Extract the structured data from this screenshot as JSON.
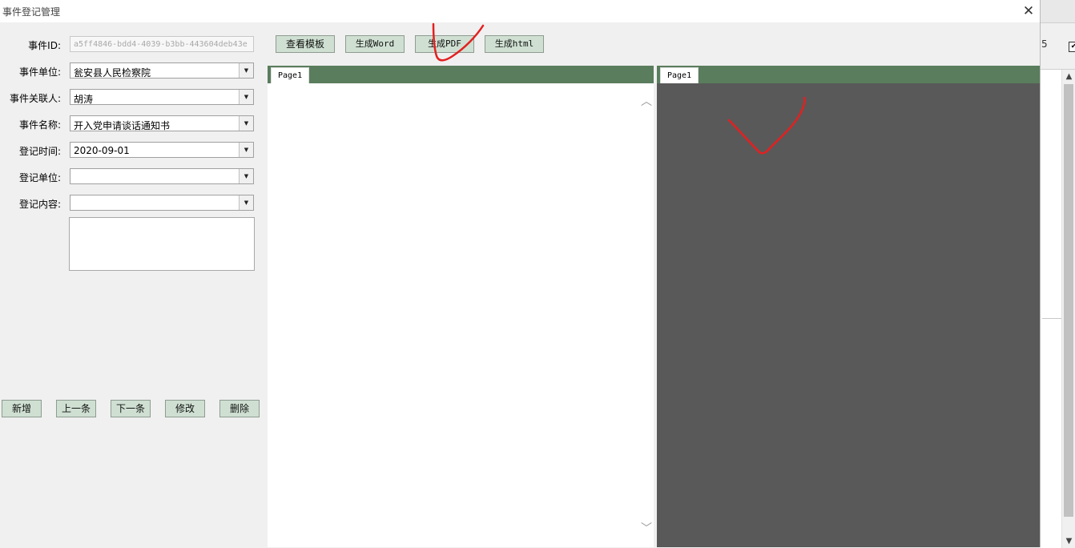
{
  "window": {
    "title": "事件登记管理",
    "close_glyph": "✕"
  },
  "form": {
    "event_id": {
      "label": "事件ID:",
      "value": "a5ff4846-bdd4-4039-b3bb-443604deb43e"
    },
    "event_unit": {
      "label": "事件单位:",
      "value": "瓮安县人民检察院"
    },
    "event_contact": {
      "label": "事件关联人:",
      "value": "胡涛"
    },
    "event_name": {
      "label": "事件名称:",
      "value": "开入党申请谈话通知书"
    },
    "register_time": {
      "label": "登记时间:",
      "value": "2020-09-01"
    },
    "register_unit": {
      "label": "登记单位:",
      "value": ""
    },
    "register_content": {
      "label": "登记内容:",
      "value": ""
    },
    "dropdown_glyph": "▼"
  },
  "toolbar": {
    "view_template": "查看模板",
    "gen_word": "生成Word",
    "gen_pdf": "生成PDF",
    "gen_html": "生成html"
  },
  "nav_buttons": {
    "add": "新增",
    "prev": "上一条",
    "next": "下一条",
    "edit": "修改",
    "delete": "删除"
  },
  "left_viewer": {
    "tab": "Page1",
    "scroll_up": "︿",
    "scroll_down": "﹀"
  },
  "right_viewer": {
    "tab": "Page1"
  },
  "background_window": {
    "fragment_text": "5",
    "checkbox_glyph": "✔",
    "scroll_up": "▲",
    "scroll_down": "▼"
  },
  "colors": {
    "button_bg": "#cfe0d2",
    "tabstrip": "#5a7d5d",
    "viewer_dark": "#595959",
    "annotation": "#e32020"
  },
  "icons": {
    "close": "close-icon",
    "dropdown": "chevron-down-icon"
  }
}
